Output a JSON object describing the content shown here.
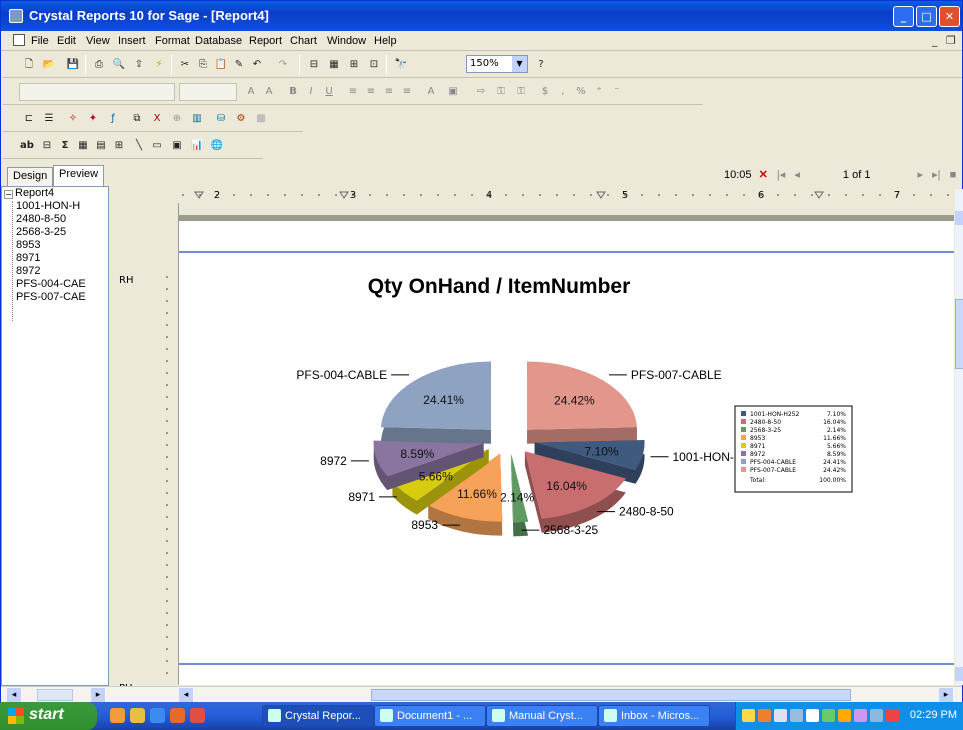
{
  "window": {
    "title": "Crystal Reports 10 for Sage - [Report4]"
  },
  "menu": [
    "File",
    "Edit",
    "View",
    "Insert",
    "Format",
    "Database",
    "Report",
    "Chart",
    "Window",
    "Help"
  ],
  "toolbar": {
    "zoom": "150%"
  },
  "tabs": {
    "design": "Design",
    "preview": "Preview"
  },
  "nav": {
    "time": "10:05",
    "page": "1 of 1"
  },
  "tree": {
    "root": "Report4",
    "items": [
      "1001-HON-H",
      "2480-8-50",
      "2568-3-25",
      "8953",
      "8971",
      "8972",
      "PFS-004-CAE",
      "PFS-007-CAE"
    ]
  },
  "sections": {
    "rh": "RH",
    "ph": "PH"
  },
  "ruler": {
    "labels": [
      "2",
      "3",
      "4",
      "5",
      "6",
      "7"
    ]
  },
  "chart_data": {
    "type": "pie",
    "title": "Qty OnHand / ItemNumber",
    "categories": [
      "1001-HON-H252",
      "2480-8-50",
      "2568-3-25",
      "8953",
      "8971",
      "8972",
      "PFS-004-CABLE",
      "PFS-007-CABLE"
    ],
    "values": [
      7.1,
      16.04,
      2.14,
      11.66,
      5.66,
      8.59,
      24.41,
      24.42
    ],
    "value_labels": [
      "7.10%",
      "16.04%",
      "2.14%",
      "11.66%",
      "5.66%",
      "8.59%",
      "24.41%",
      "24.42%"
    ],
    "colors": [
      "#40597f",
      "#c86e6e",
      "#5f9a62",
      "#f6a25a",
      "#d8cc10",
      "#8a74a0",
      "#8ea2c2",
      "#e2968c"
    ],
    "legend": {
      "placement": "right",
      "labels": [
        "1001-HON-H252",
        "2480-8-50",
        "2568-3-25",
        "8953",
        "8971",
        "8972",
        "PFS-004-CABLE",
        "PFS-007-CABLE"
      ],
      "values": [
        "7.10%",
        "16.04%",
        "2.14%",
        "11.66%",
        "5.66%",
        "8.59%",
        "24.41%",
        "24.42%"
      ],
      "total_label": "Total:",
      "total_value": "100.00%"
    }
  },
  "taskbar": {
    "start": "start",
    "tasks": [
      "Crystal Repor...",
      "Document1 - ...",
      "Manual Cryst...",
      "Inbox - Micros..."
    ],
    "clock": "02:29 PM"
  }
}
